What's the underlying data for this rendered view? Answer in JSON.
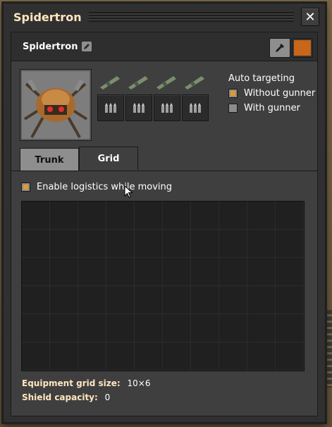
{
  "window": {
    "title": "Spidertron",
    "close_symbol": "✕"
  },
  "entity": {
    "name": "Spidertron",
    "color": "#c8661a"
  },
  "icons": {
    "rename": "pencil-icon",
    "pipette": "pipette-icon",
    "weapon": "rocket-launcher-icon",
    "ammo": "ammo-icon"
  },
  "weapons": {
    "count": 4
  },
  "targeting": {
    "heading": "Auto targeting",
    "options": [
      {
        "label": "Without gunner",
        "checked": true
      },
      {
        "label": "With gunner",
        "checked": false
      }
    ]
  },
  "tabs": [
    {
      "label": "Trunk",
      "active": false
    },
    {
      "label": "Grid",
      "active": true
    }
  ],
  "logistics": {
    "label": "Enable logistics while moving",
    "checked": true
  },
  "grid": {
    "columns": 10,
    "rows": 6
  },
  "stats": {
    "grid_size_label": "Equipment grid size:",
    "grid_size_value": "10×6",
    "shield_label": "Shield capacity:",
    "shield_value": "0"
  }
}
